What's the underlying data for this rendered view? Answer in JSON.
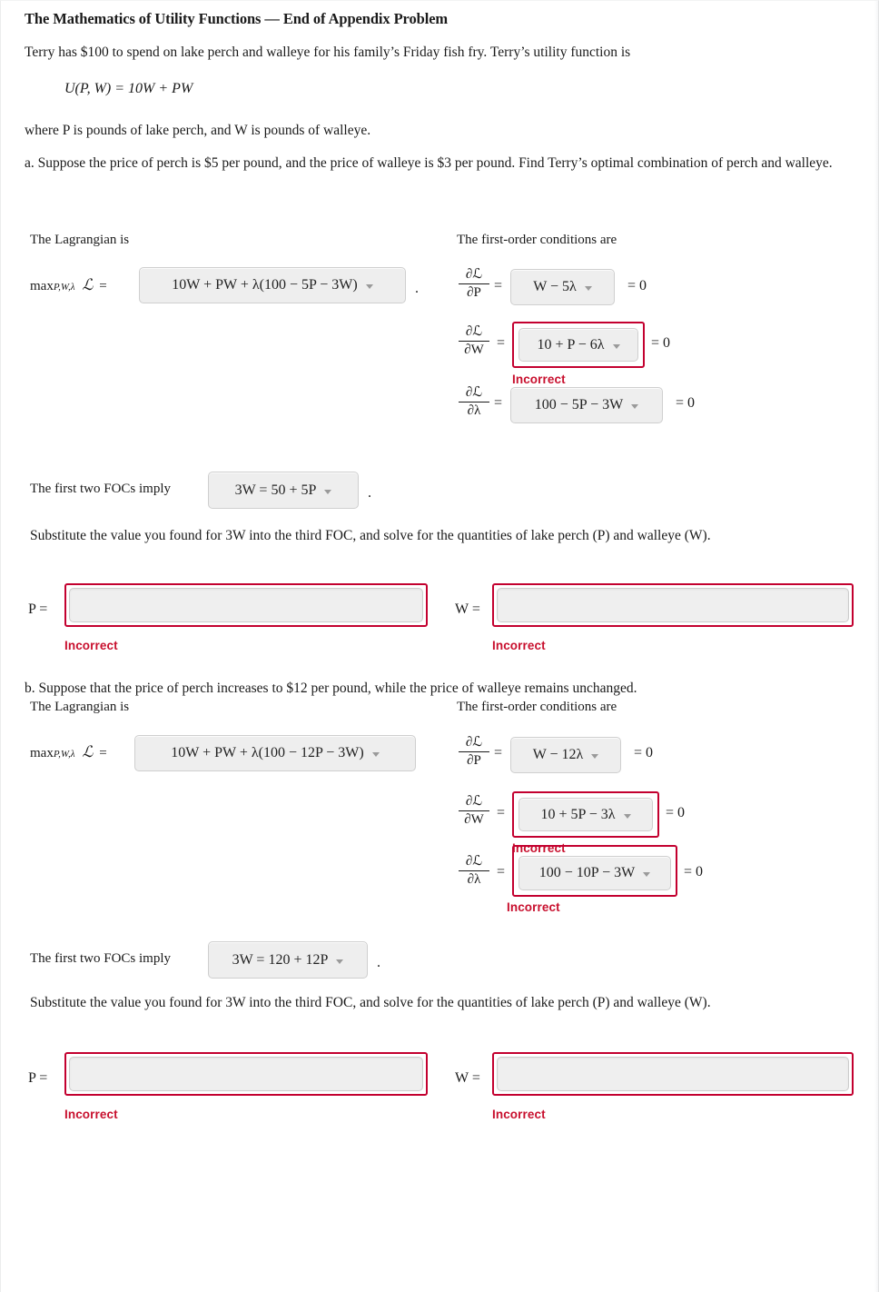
{
  "document": {
    "title": "The Mathematics of Utility Functions — End of Appendix Problem",
    "intro": "Terry has $100 to spend on lake perch and walleye for his family’s Friday fish fry. Terry’s utility function is",
    "utility_equation": "U(P, W) = 10W + PW",
    "where_line": "where P is pounds of lake perch, and W is pounds of walleye.",
    "part_a_prompt": "a. Suppose the price of perch is $5 per pound, and the price of walleye is $3 per pound. Find Terry’s optimal combination of perch and walleye.",
    "part_b_prompt": "b. Suppose that the price of perch increases to $12 per pound, while the price of walleye remains unchanged.",
    "lagrangian_label": "The Lagrangian is",
    "foc_label": "The first-order conditions are",
    "foc_imply_label": "The first two FOCs imply",
    "substitute_instruction": "Substitute the value you found for 3W into the third FOC, and solve for the quantities of lake perch (P) and walleye (W).",
    "incorrect_label": "Incorrect",
    "period": ".",
    "equals": "=",
    "equals_zero": "= 0",
    "max_prefix": "max",
    "max_subscript": "P,W,λ",
    "lagrangian_symbol": "ℒ",
    "error_color": "#c8102e",
    "error_border_color": "#c3002f",
    "control_bg": "#eeeeee",
    "input_bg": "#efefef"
  },
  "part_a": {
    "lagrangian_value": "10W + PW + λ(100 − 5P − 3W)",
    "focs": [
      {
        "derivative_num": "∂ℒ",
        "derivative_den": "∂P",
        "value": "W − 5λ",
        "incorrect": false
      },
      {
        "derivative_num": "∂ℒ",
        "derivative_den": "∂W",
        "value": "10 + P − 6λ",
        "incorrect": true
      },
      {
        "derivative_num": "∂ℒ",
        "derivative_den": "∂λ",
        "value": "100 − 5P − 3W",
        "incorrect": false
      }
    ],
    "focs_imply_value": "3W = 50 + 5P",
    "answers": [
      {
        "label": "P =",
        "value": "",
        "incorrect": true
      },
      {
        "label": "W =",
        "value": "",
        "incorrect": true
      }
    ]
  },
  "part_b": {
    "lagrangian_value": "10W + PW + λ(100 − 12P − 3W)",
    "focs": [
      {
        "derivative_num": "∂ℒ",
        "derivative_den": "∂P",
        "value": "W − 12λ",
        "incorrect": false
      },
      {
        "derivative_num": "∂ℒ",
        "derivative_den": "∂W",
        "value": "10 + 5P − 3λ",
        "incorrect": true
      },
      {
        "derivative_num": "∂ℒ",
        "derivative_den": "∂λ",
        "value": "100 − 10P − 3W",
        "incorrect": true
      }
    ],
    "focs_imply_value": "3W = 120 + 12P",
    "answers": [
      {
        "label": "P =",
        "value": "",
        "incorrect": true
      },
      {
        "label": "W =",
        "value": "",
        "incorrect": true
      }
    ]
  }
}
